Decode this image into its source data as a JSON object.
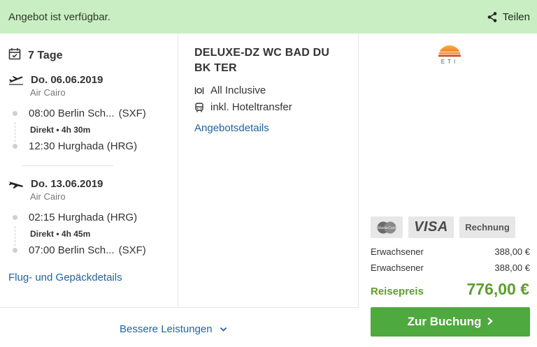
{
  "banner": {
    "title": "Angebot ist verfügbar.",
    "share_label": "Teilen"
  },
  "trip": {
    "duration": "7 Tage",
    "outbound": {
      "date": "Do. 06.06.2019",
      "airline": "Air Cairo",
      "depart_time_place": "08:00 Berlin Sch...",
      "depart_code": "(SXF)",
      "direct": "Direkt",
      "bullet": "•",
      "duration": "4h 30m",
      "arrive_time_place": "12:30 Hurghada (HRG)"
    },
    "return": {
      "date": "Do. 13.06.2019",
      "airline": "Air Cairo",
      "depart_time_place": "02:15 Hurghada (HRG)",
      "direct": "Direkt",
      "bullet": "•",
      "duration": "4h 45m",
      "arrive_time_place": "07:00 Berlin Sch...",
      "arrive_code": "(SXF)"
    },
    "details_link": "Flug- und Gepäckdetails"
  },
  "hotel": {
    "room": "DELUXE-DZ WC BAD DU BK TER",
    "board": "All Inclusive",
    "transfer": "inkl. Hoteltransfer",
    "details_link": "Angebotsdetails"
  },
  "operator": {
    "logo_text": "ETI"
  },
  "payment": {
    "mastercard": "MasterCard",
    "visa": "VISA",
    "invoice": "Rechnung"
  },
  "prices": {
    "rows": [
      {
        "label": "Erwachsener",
        "value": "388,00 €"
      },
      {
        "label": "Erwachsener",
        "value": "388,00 €"
      }
    ],
    "total_label": "Reisepreis",
    "total_value": "776,00 €"
  },
  "actions": {
    "book": "Zur Buchung",
    "more": "Bessere Leistungen"
  },
  "colors": {
    "banner": "#c9eec3",
    "accent_green": "#5c9e2f",
    "button_green": "#4ea93e",
    "link_blue": "#1e63a8"
  },
  "icons": [
    "share-icon",
    "calendar-icon",
    "plane-departure-icon",
    "plane-arrival-icon",
    "cutlery-icon",
    "bus-icon",
    "chevron-right-icon",
    "chevron-down-icon"
  ]
}
